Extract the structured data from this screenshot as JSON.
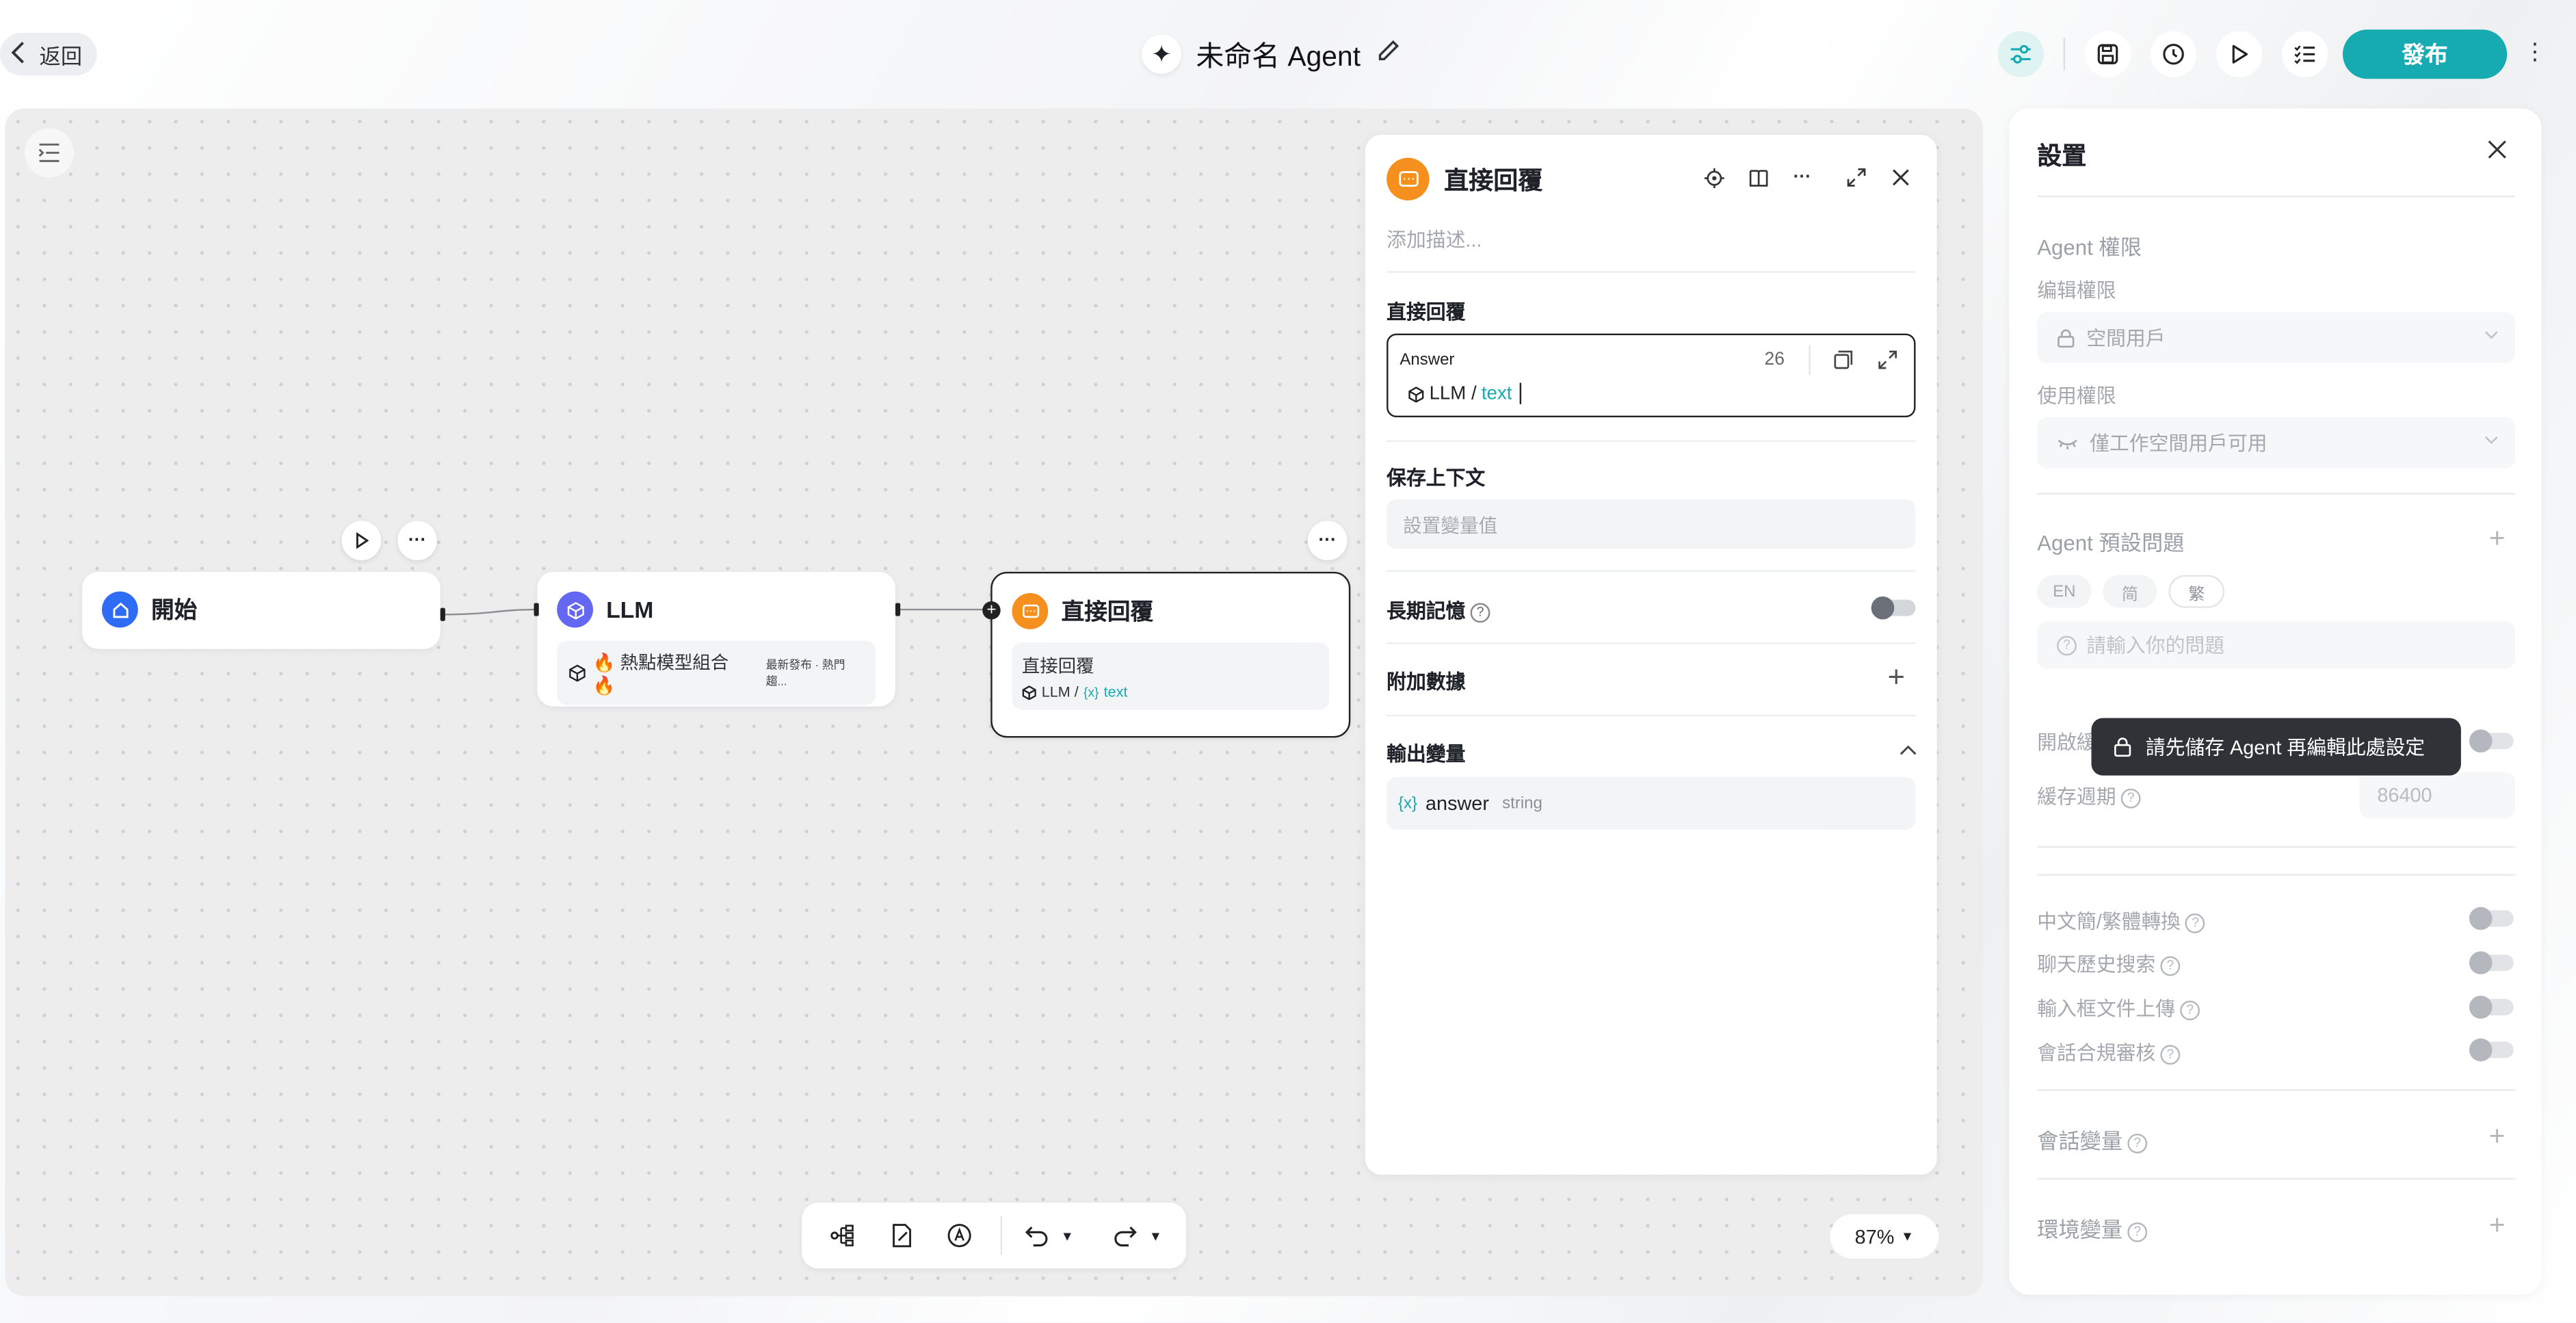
{
  "topbar": {
    "back_label": "返回",
    "title": "未命名 Agent",
    "publish_label": "發布"
  },
  "canvas": {
    "zoom": "87%",
    "nodes": {
      "start": {
        "label": "開始",
        "color": "#2f6cf6"
      },
      "llm": {
        "label": "LLM",
        "color": "#6467f2",
        "model": "🔥 熱點模型組合 🔥",
        "model_meta": "最新發布 · 熱門趨..."
      },
      "reply": {
        "label": "直接回覆",
        "color": "#f5901e",
        "sub_title": "直接回覆",
        "sub_source": "LLM /",
        "sub_var": "text"
      }
    }
  },
  "detail": {
    "title": "直接回覆",
    "description_placeholder": "添加描述...",
    "section_reply": "直接回覆",
    "answer_label": "Answer",
    "answer_count": "26",
    "answer_source": "LLM /",
    "answer_var": "text",
    "section_context": "保存上下文",
    "context_placeholder": "設置變量值",
    "section_memory": "長期記憶",
    "section_extra": "附加數據",
    "section_output": "輸出變量",
    "output_var": {
      "name": "answer",
      "type": "string"
    }
  },
  "settings": {
    "title": "設置",
    "perm_section": "Agent 權限",
    "edit_perm_label": "编辑權限",
    "edit_perm_value": "空間用戶",
    "use_perm_label": "使用權限",
    "use_perm_value": "僅工作空間用戶可用",
    "preset_section": "Agent 預設問題",
    "langs": [
      "EN",
      "简",
      "繁"
    ],
    "question_placeholder": "請輸入你的問題",
    "cache_label": "開啟緩",
    "cache_period_label": "緩存週期",
    "cache_period_value": "86400",
    "toggles": [
      "中文簡/繁體轉換",
      "聊天歷史搜索",
      "輸入框文件上傳",
      "會話合規審核"
    ],
    "session_vars": "會話變量",
    "env_vars": "環境變量",
    "tooltip": "請先儲存 Agent 再編輯此處設定"
  }
}
